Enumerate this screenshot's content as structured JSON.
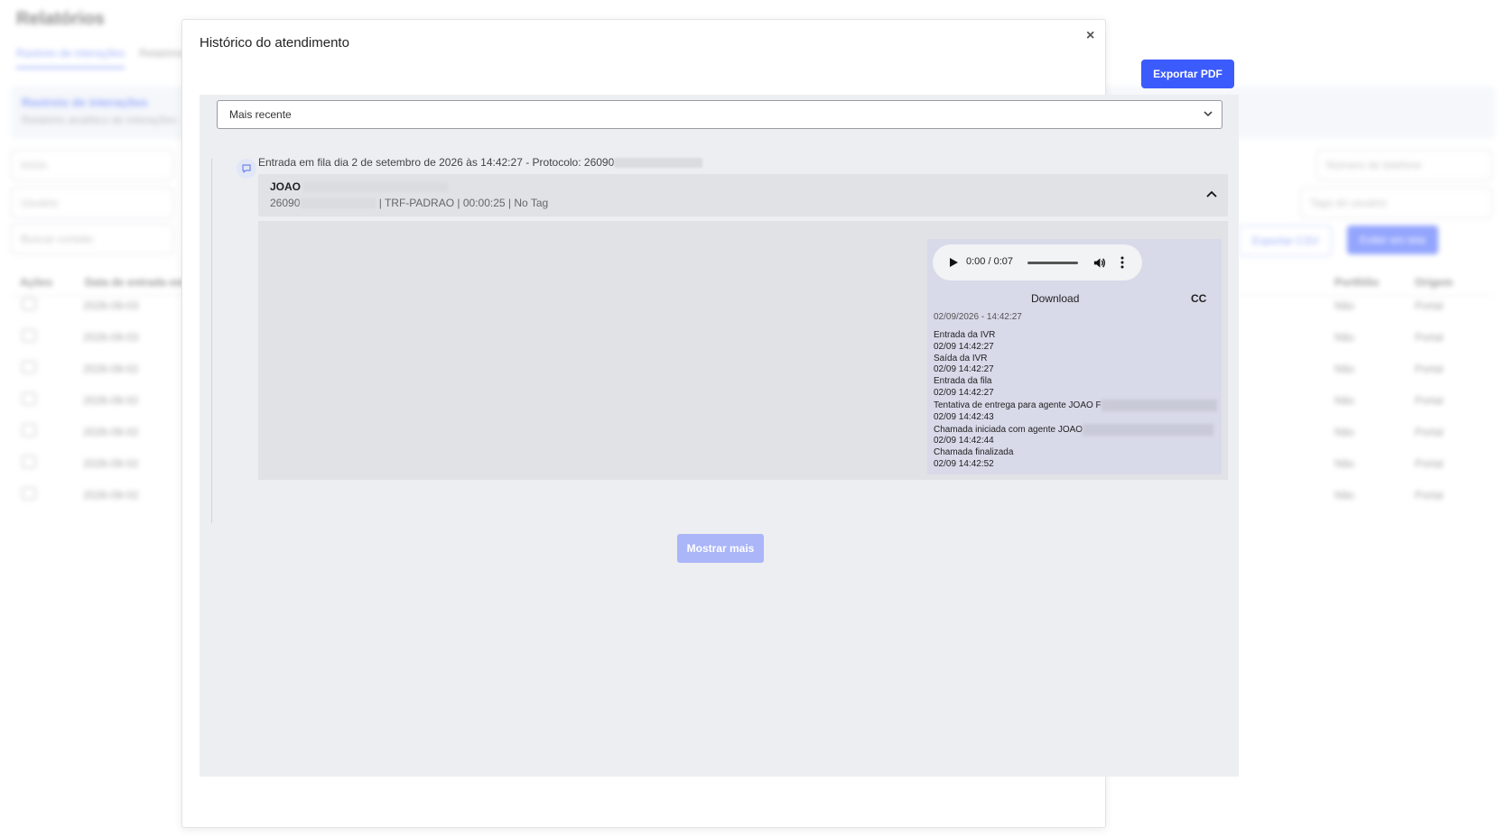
{
  "background": {
    "title": "Relatórios",
    "tabs": [
      "Rastreio de interações",
      "Relatórios"
    ],
    "section_title": "Rastreio de interações",
    "section_subtitle": "Relatório analítico de interações",
    "fields": {
      "start_date": "Início",
      "user": "Usuário",
      "search_contact": "Buscar contato",
      "phone": "Número de telefone",
      "user_tags": "Tags do usuário"
    },
    "buttons": {
      "export_csv": "Exportar CSV",
      "edit_columns": "Exibir em tela"
    },
    "table": {
      "headers": [
        "Ações",
        "Data de entrada em fila",
        "Portfólio",
        "Origem"
      ],
      "rows": [
        {
          "date": "2026-09-03",
          "portfolio": "Não",
          "origin": "Portal"
        },
        {
          "date": "2026-09-03",
          "portfolio": "Não",
          "origin": "Portal"
        },
        {
          "date": "2026-09-02",
          "portfolio": "Não",
          "origin": "Portal"
        },
        {
          "date": "2026-09-02",
          "portfolio": "Não",
          "origin": "Portal"
        },
        {
          "date": "2026-09-02",
          "portfolio": "Não",
          "origin": "Portal"
        },
        {
          "date": "2026-09-02",
          "portfolio": "Não",
          "origin": "Portal"
        },
        {
          "date": "2026-09-02",
          "portfolio": "Não",
          "origin": "Portal"
        }
      ]
    }
  },
  "modal": {
    "title": "Histórico do atendimento",
    "close_label": "×",
    "export_button": "Exportar PDF",
    "sort": {
      "selected": "Mais recente"
    },
    "event": {
      "header": "Entrada em fila dia 2 de setembro de 2026 às 14:42:27 - Protocolo: 26090",
      "call": {
        "agent": "JOAO",
        "protocol_prefix": "26090",
        "queue": "TRF-PADRAO",
        "duration": "00:00:25",
        "tag": "No Tag"
      },
      "recording": {
        "time": "0:00 / 0:07",
        "download_label": "Download",
        "cc_label": "CC",
        "date": "02/09/2026 - 14:42:27",
        "log": [
          {
            "label": "Entrada da IVR",
            "time": "02/09 14:42:27"
          },
          {
            "label": "Saída da IVR",
            "time": "02/09 14:42:27"
          },
          {
            "label": "Entrada da fila",
            "time": "02/09 14:42:27"
          },
          {
            "label": "Tentativa de entrega para agente JOAO F",
            "time": "02/09 14:42:43"
          },
          {
            "label": "Chamada iniciada com agente JOAO",
            "time": "02/09 14:42:44"
          },
          {
            "label": "Chamada finalizada",
            "time": "02/09 14:42:52"
          }
        ]
      }
    },
    "more_button": "Mostrar mais"
  }
}
